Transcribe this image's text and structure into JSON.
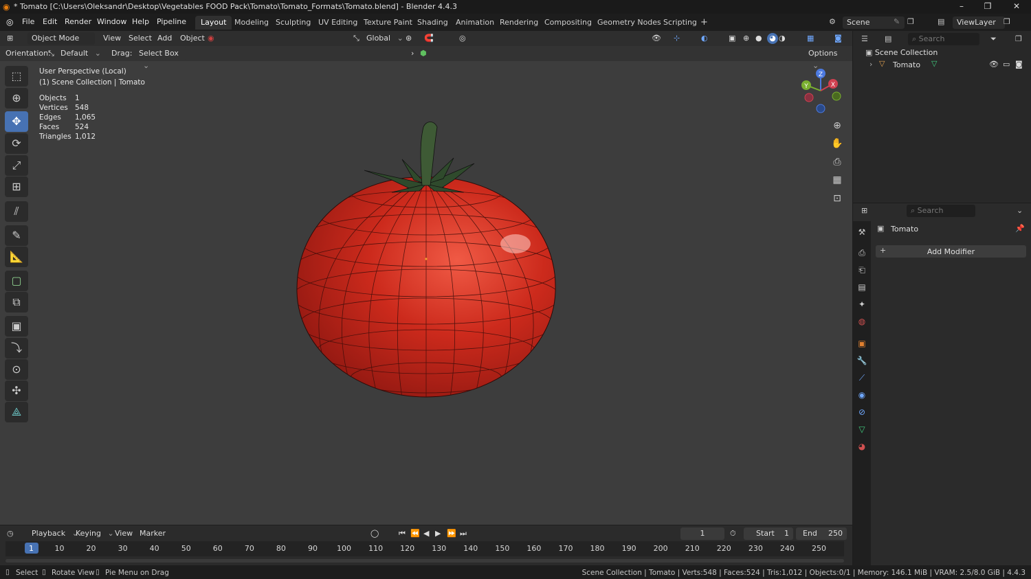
{
  "window": {
    "title": "* Tomato [C:\\Users\\Oleksandr\\Desktop\\Vegetables FOOD Pack\\Tomato\\Tomato_Formats\\Tomato.blend] - Blender 4.4.3"
  },
  "menu": [
    "File",
    "Edit",
    "Render",
    "Window",
    "Help",
    "Pipeline"
  ],
  "workspaces": [
    "Layout",
    "Modeling",
    "Sculpting",
    "UV Editing",
    "Texture Paint",
    "Shading",
    "Animation",
    "Rendering",
    "Compositing",
    "Geometry Nodes",
    "Scripting"
  ],
  "scene": {
    "label": "Scene",
    "viewlayer": "ViewLayer"
  },
  "viewport_header": {
    "mode": "Object Mode",
    "view": "View",
    "select": "Select",
    "add": "Add",
    "object": "Object",
    "transform_orientation": "Global",
    "orientation_label": "Orientation:",
    "orientation_value": "Default",
    "drag_label": "Drag:",
    "drag_value": "Select Box",
    "options": "Options"
  },
  "overlay": {
    "line1": "User Perspective (Local)",
    "line2": "(1) Scene Collection | Tomato",
    "stats": [
      {
        "label": "Objects",
        "value": "1"
      },
      {
        "label": "Vertices",
        "value": "548"
      },
      {
        "label": "Edges",
        "value": "1,065"
      },
      {
        "label": "Faces",
        "value": "524"
      },
      {
        "label": "Triangles",
        "value": "1,012"
      }
    ]
  },
  "gizmo": {
    "z": "Z",
    "y": "Y",
    "x": "X"
  },
  "outliner": {
    "search_placeholder": "Search",
    "collection": "Scene Collection",
    "object": "Tomato"
  },
  "properties": {
    "search_placeholder": "Search",
    "object_name": "Tomato",
    "add_modifier": "Add Modifier"
  },
  "timeline": {
    "playback": "Playback",
    "keying": "Keying",
    "view": "View",
    "marker": "Marker",
    "current_frame": "1",
    "start_label": "Start",
    "start_value": "1",
    "end_label": "End",
    "end_value": "250",
    "ticks": [
      "1",
      "10",
      "20",
      "30",
      "40",
      "50",
      "60",
      "70",
      "80",
      "90",
      "100",
      "110",
      "120",
      "130",
      "140",
      "150",
      "160",
      "170",
      "180",
      "190",
      "200",
      "210",
      "220",
      "230",
      "240",
      "250"
    ]
  },
  "statusbar": {
    "select": "Select",
    "rotate": "Rotate View",
    "pie": "Pie Menu on Drag",
    "info": "Scene Collection | Tomato | Verts:548 | Faces:524 | Tris:1,012 | Objects:0/1 | Memory: 146.1 MiB | VRAM: 2.5/8.0 GiB | 4.4.3"
  },
  "colors": {
    "accent": "#4772b3",
    "tomato": "#c8281a",
    "stem": "#3e5a35"
  }
}
